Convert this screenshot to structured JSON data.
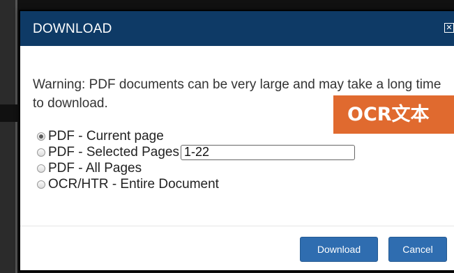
{
  "dialog": {
    "title": "DOWNLOAD",
    "close_icon": "close-icon"
  },
  "warning_text": "Warning: PDF documents can be very large and may take a long time to download.",
  "options": [
    {
      "label": "PDF - Current page",
      "selected": true
    },
    {
      "label": "PDF - Selected Pages",
      "selected": false
    },
    {
      "label": "PDF - All Pages",
      "selected": false
    },
    {
      "label": "OCR/HTR - Entire Document",
      "selected": false
    }
  ],
  "pages_input": {
    "value": "1-22"
  },
  "badge": {
    "text": "OCR文本"
  },
  "buttons": {
    "download_label": "Download",
    "cancel_label": "Cancel"
  },
  "colors": {
    "header": "#0e3a66",
    "button": "#2f6db0",
    "badge": "#e06a2f"
  }
}
